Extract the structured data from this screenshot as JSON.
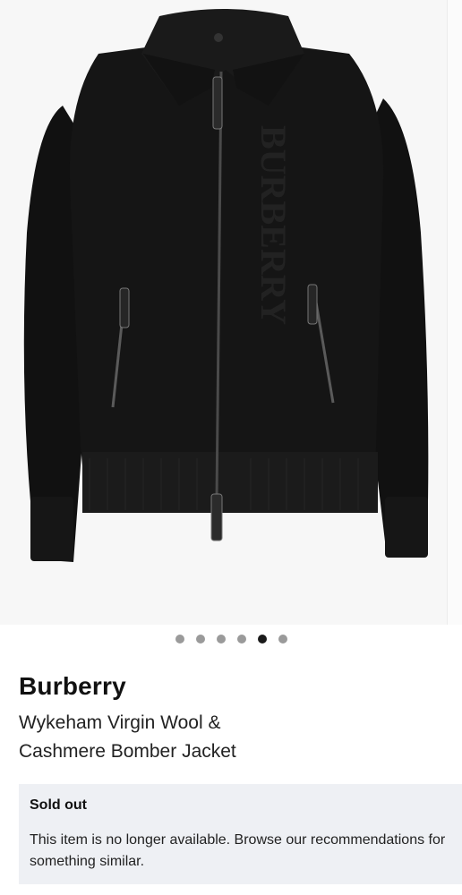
{
  "product": {
    "brand": "Burberry",
    "name_line1": "Wykeham Virgin Wool &",
    "name_line2": "Cashmere Bomber Jacket",
    "image_icon": "black-bomber-jacket-image",
    "image_text": "BURBERRY"
  },
  "gallery": {
    "dot_count": 6,
    "active_dot": 5
  },
  "availability": {
    "title": "Sold out",
    "message": "This item is no longer available. Browse our recommendations for something similar."
  },
  "colors": {
    "notice_bg": "#eef0f4",
    "dot_inactive": "#9a9a9a",
    "dot_active": "#1a1a1a"
  }
}
